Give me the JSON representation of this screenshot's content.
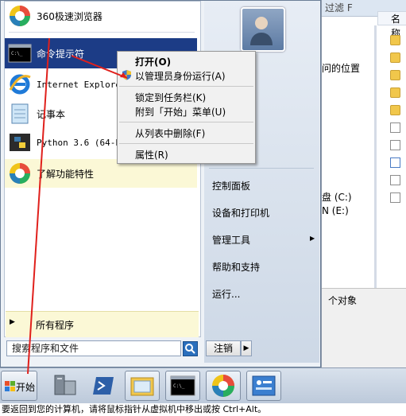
{
  "explorer": {
    "title_fragment": "过滤 F",
    "column_header": "名称",
    "location_fragment": "问的位置",
    "drive_c": "盘 (C:)",
    "drive_e": "N (E:)",
    "item_count": "个对象"
  },
  "start_menu": {
    "pinned": [
      {
        "label": "360极速浏览器",
        "icon": "browser-360-icon"
      },
      {
        "label": "命令提示符",
        "icon": "cmd-icon"
      },
      {
        "label": "Internet Explorer",
        "icon": "ie-icon"
      },
      {
        "label": "记事本",
        "icon": "notepad-icon"
      },
      {
        "label": "Python 3.6 (64-bit)",
        "icon": "python-icon"
      },
      {
        "label": "了解功能特性",
        "icon": "features-icon"
      }
    ],
    "all_programs": "所有程序",
    "search_placeholder": "搜索程序和文件",
    "logoff": "注销",
    "right_links": [
      "控制面板",
      "设备和打印机",
      "管理工具",
      "帮助和支持",
      "运行..."
    ]
  },
  "context_menu": {
    "items": [
      {
        "label": "打开(O)",
        "bold": true
      },
      {
        "label": "以管理员身份运行(A)"
      },
      {
        "label": "锁定到任务栏(K)"
      },
      {
        "label": "附到「开始」菜单(U)"
      },
      {
        "label": "从列表中删除(F)"
      },
      {
        "label": "属性(R)"
      }
    ]
  },
  "taskbar": {
    "start_label": "开始",
    "buttons": [
      "server-manager-icon",
      "powershell-icon",
      "explorer-icon",
      "cmd-icon",
      "browser-360-icon",
      "control-panel-icon"
    ]
  },
  "status_bar": {
    "text": "要返回到您的计算机，请将鼠标指针从虚拟机中移出或按 Ctrl+Alt。"
  },
  "colors": {
    "selection": "#1c3c86",
    "annotation_arrow": "#e0201c"
  }
}
